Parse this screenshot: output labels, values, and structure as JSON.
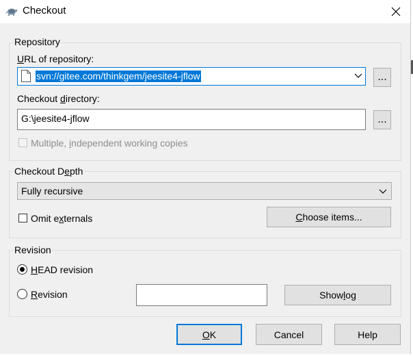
{
  "window": {
    "title": "Checkout"
  },
  "repository": {
    "group_title": "Repository",
    "url_label_pre": "",
    "url_label_u": "U",
    "url_label_post": "RL of repository:",
    "url_value": "svn://gitee.com/thinkgem/jeesite4-jflow",
    "browse_url_label": "...",
    "dir_label_pre": "Checkout ",
    "dir_label_u": "d",
    "dir_label_post": "irectory:",
    "dir_value": "G:\\jeesite4-jflow",
    "browse_dir_label": "...",
    "multiple_label_pre": "Multiple, ",
    "multiple_label_u": "i",
    "multiple_label_post": "ndependent working copies"
  },
  "depth": {
    "group_title_pre": "Checkout D",
    "group_title_u": "e",
    "group_title_post": "pth",
    "selected": "Fully recursive",
    "omit_label_pre": "Omit ",
    "omit_label_u": "x",
    "omit_label_post": "ternals",
    "omit_pre2": "e",
    "choose_pre": "",
    "choose_u": "C",
    "choose_post": "hoose items..."
  },
  "revision": {
    "group_title": "Revision",
    "head_u": "H",
    "head_post": "EAD revision",
    "rev_u": "R",
    "rev_post": "evision",
    "rev_value": "",
    "showlog_pre": "Show ",
    "showlog_u": "l",
    "showlog_post": "og"
  },
  "buttons": {
    "ok_u": "O",
    "ok_post": "K",
    "cancel": "Cancel",
    "help": "Help"
  }
}
